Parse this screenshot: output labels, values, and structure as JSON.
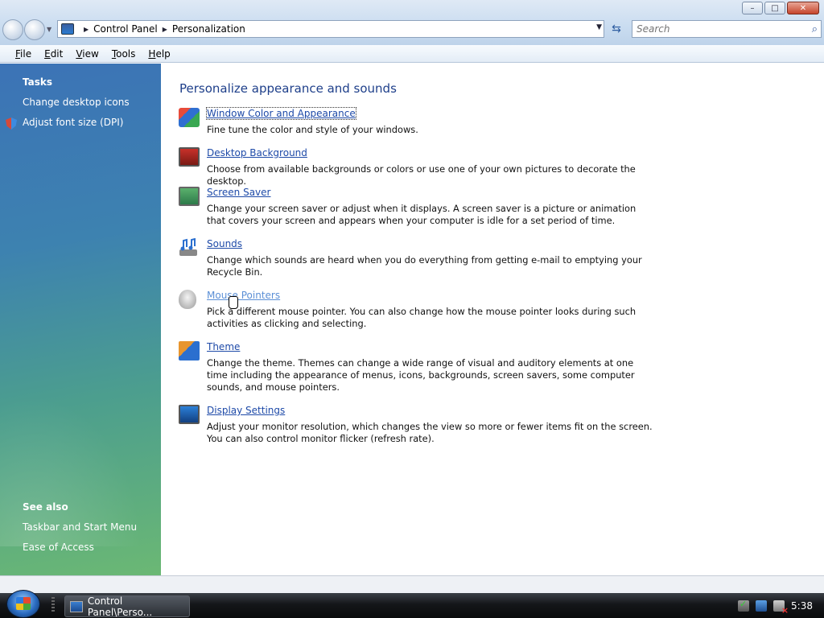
{
  "window": {
    "controls": {
      "minimize": "–",
      "maximize": "□",
      "close": "✕"
    }
  },
  "nav": {
    "breadcrumbs": [
      "Control Panel",
      "Personalization"
    ],
    "search_placeholder": "Search"
  },
  "menubar": {
    "items": [
      {
        "underline": "F",
        "rest": "ile"
      },
      {
        "underline": "E",
        "rest": "dit"
      },
      {
        "underline": "V",
        "rest": "iew"
      },
      {
        "underline": "T",
        "rest": "ools"
      },
      {
        "underline": "H",
        "rest": "elp"
      }
    ]
  },
  "sidebar": {
    "tasks_title": "Tasks",
    "tasks": [
      "Change desktop icons",
      "Adjust font size (DPI)"
    ],
    "see_also_title": "See also",
    "see_also": [
      "Taskbar and Start Menu",
      "Ease of Access"
    ]
  },
  "main": {
    "title": "Personalize appearance and sounds",
    "items": [
      {
        "label": "Window Color and Appearance",
        "icon": "window-color-icon",
        "desc": "Fine tune the color and style of your windows."
      },
      {
        "label": "Desktop Background",
        "icon": "desktop-background-icon",
        "desc": "Choose from available backgrounds or colors or use one of your own pictures to decorate the desktop."
      },
      {
        "label": "Screen Saver",
        "icon": "screen-saver-icon",
        "desc": "Change your screen saver or adjust when it displays. A screen saver is a picture or animation that covers your screen and appears when your computer is idle for a set period of time."
      },
      {
        "label": "Sounds",
        "icon": "sounds-icon",
        "desc": "Change which sounds are heard when you do everything from getting e-mail to emptying your Recycle Bin."
      },
      {
        "label": "Mouse Pointers",
        "icon": "mouse-pointers-icon",
        "desc": "Pick a different mouse pointer. You can also change how the mouse pointer looks during such activities as clicking and selecting."
      },
      {
        "label": "Theme",
        "icon": "theme-icon",
        "desc": "Change the theme. Themes can change a wide range of visual and auditory elements at one time including the appearance of menus, icons, backgrounds, screen savers, some computer sounds, and mouse pointers."
      },
      {
        "label": "Display Settings",
        "icon": "display-settings-icon",
        "desc": "Adjust your monitor resolution, which changes the view so more or fewer items fit on the screen. You can also control monitor flicker (refresh rate)."
      }
    ]
  },
  "taskbar": {
    "task_label": "Control Panel\\Perso...",
    "clock": "5:38"
  }
}
